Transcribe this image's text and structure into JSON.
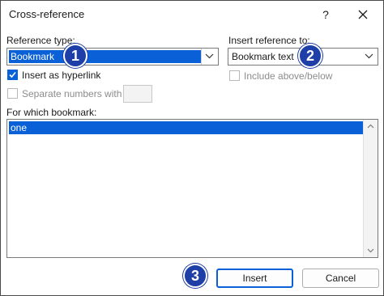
{
  "dialog": {
    "title": "Cross-reference",
    "help_label": "?"
  },
  "reference_type": {
    "label": "Reference type:",
    "value": "Bookmark"
  },
  "insert_reference_to": {
    "label": "Insert reference to:",
    "value": "Bookmark text"
  },
  "options": {
    "insert_as_hyperlink": {
      "label": "Insert as hyperlink",
      "checked": true
    },
    "include_above_below": {
      "label": "Include above/below",
      "checked": false,
      "enabled": false
    },
    "separate_numbers_with": {
      "label": "Separate numbers with",
      "checked": false,
      "enabled": false,
      "value": ""
    }
  },
  "for_which": {
    "label": "For which bookmark:",
    "items": [
      "one"
    ],
    "selected": "one"
  },
  "buttons": {
    "insert": "Insert",
    "cancel": "Cancel"
  },
  "callouts": [
    "1",
    "2",
    "3"
  ],
  "colors": {
    "accent": "#0a60d6",
    "callout": "#1e3ea8"
  }
}
